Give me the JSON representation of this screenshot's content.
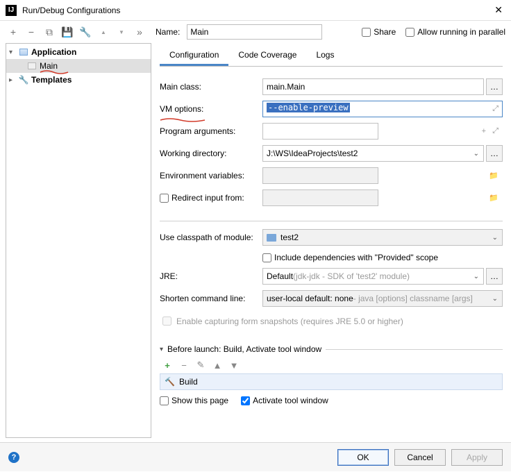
{
  "window": {
    "title": "Run/Debug Configurations"
  },
  "top": {
    "name_label": "Name:",
    "name_value": "Main",
    "share": "Share",
    "parallel": "Allow running in parallel"
  },
  "tree": {
    "application": "Application",
    "main": "Main",
    "templates": "Templates"
  },
  "tabs": {
    "configuration": "Configuration",
    "code_coverage": "Code Coverage",
    "logs": "Logs"
  },
  "fields": {
    "main_class": {
      "label": "Main class:",
      "value": "main.Main"
    },
    "vm_options": {
      "label": "VM options:",
      "value": "--enable-preview"
    },
    "prog_args": {
      "label": "Program arguments:",
      "value": ""
    },
    "work_dir": {
      "label": "Working directory:",
      "value": "J:\\WS\\IdeaProjects\\test2"
    },
    "env_vars": {
      "label": "Environment variables:",
      "value": ""
    },
    "redirect": {
      "label": "Redirect input from:",
      "value": ""
    },
    "classpath": {
      "label": "Use classpath of module:",
      "value": "test2"
    },
    "include_provided": "Include dependencies with \"Provided\" scope",
    "jre": {
      "label": "JRE:",
      "value": "Default ",
      "hint": "(jdk-jdk - SDK of 'test2' module)"
    },
    "shorten": {
      "label": "Shorten command line:",
      "value": "user-local default: none",
      "hint": " - java [options] classname [args]"
    },
    "enable_snapshots": "Enable capturing form snapshots (requires JRE 5.0 or higher)"
  },
  "before": {
    "title": "Before launch: Build, Activate tool window",
    "build": "Build",
    "show_page": "Show this page",
    "activate": "Activate tool window"
  },
  "buttons": {
    "ok": "OK",
    "cancel": "Cancel",
    "apply": "Apply"
  }
}
